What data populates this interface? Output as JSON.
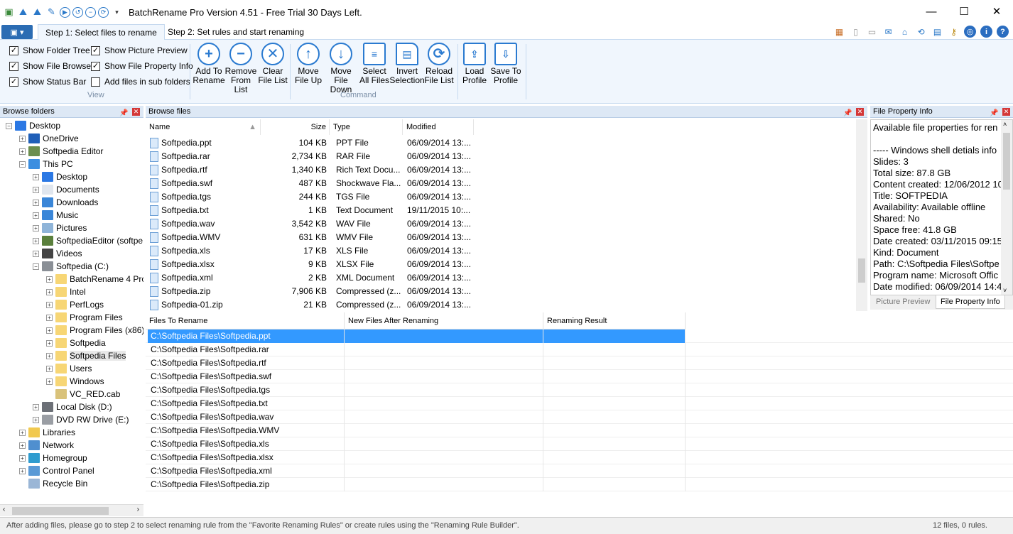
{
  "window": {
    "title": "BatchRename Pro Version 4.51 - Free Trial 30 Days Left.",
    "minimize": "—",
    "maximize": "☐",
    "close": "✕"
  },
  "tabs": [
    {
      "label": "Step 1: Select files to rename",
      "active": true
    },
    {
      "label": "Step 2: Set rules and start renaming",
      "active": false
    }
  ],
  "ribbon": {
    "view_group_label": "View",
    "command_group_label": "Command",
    "checkboxes": [
      {
        "label": "Show Folder Tree",
        "checked": true
      },
      {
        "label": "Show Picture Preview",
        "checked": true
      },
      {
        "label": "Show File Browser",
        "checked": true
      },
      {
        "label": "Show File Property Info",
        "checked": true
      },
      {
        "label": "Show Status Bar",
        "checked": true
      },
      {
        "label": "Add files in sub folders",
        "checked": false
      }
    ],
    "commands": [
      {
        "line1": "Add To",
        "line2": "Rename",
        "icon": "+"
      },
      {
        "line1": "Remove",
        "line2": "From List",
        "icon": "−"
      },
      {
        "line1": "Clear",
        "line2": "File List",
        "icon": "✕"
      },
      {
        "line1": "Move",
        "line2": "File Up",
        "icon": "↑"
      },
      {
        "line1": "Move File",
        "line2": "Down",
        "icon": "↓"
      },
      {
        "line1": "Select",
        "line2": "All Files",
        "icon": "≡"
      },
      {
        "line1": "Invert",
        "line2": "Selection",
        "icon": "▤"
      },
      {
        "line1": "Reload",
        "line2": "File List",
        "icon": "⟳"
      },
      {
        "line1": "Load",
        "line2": "Profile",
        "icon": "⇪"
      },
      {
        "line1": "Save To",
        "line2": "Profile",
        "icon": "⇩"
      }
    ]
  },
  "panels": {
    "browse_folders": "Browse folders",
    "browse_files": "Browse files",
    "file_property_info": "File Property Info"
  },
  "tree": [
    {
      "label": "Desktop",
      "indent": 0,
      "exp": "−",
      "color": "#2b78e4"
    },
    {
      "label": "OneDrive",
      "indent": 1,
      "exp": "+",
      "color": "#1f5fb8"
    },
    {
      "label": "Softpedia Editor",
      "indent": 1,
      "exp": "+",
      "color": "#6b8e4e"
    },
    {
      "label": "This PC",
      "indent": 1,
      "exp": "−",
      "color": "#3b8ee0"
    },
    {
      "label": "Desktop",
      "indent": 2,
      "exp": "+",
      "color": "#2b78e4"
    },
    {
      "label": "Documents",
      "indent": 2,
      "exp": "+",
      "color": "#e0e6ee"
    },
    {
      "label": "Downloads",
      "indent": 2,
      "exp": "+",
      "color": "#3a86d8"
    },
    {
      "label": "Music",
      "indent": 2,
      "exp": "+",
      "color": "#3a86d8"
    },
    {
      "label": "Pictures",
      "indent": 2,
      "exp": "+",
      "color": "#8fb4d8"
    },
    {
      "label": "SoftpediaEditor (softpe",
      "indent": 2,
      "exp": "+",
      "color": "#5a7f3c"
    },
    {
      "label": "Videos",
      "indent": 2,
      "exp": "+",
      "color": "#444444"
    },
    {
      "label": "Softpedia (C:)",
      "indent": 2,
      "exp": "−",
      "color": "#8a8f96"
    },
    {
      "label": "BatchRename 4 Pro",
      "indent": 3,
      "exp": "+",
      "color": "#f7d675"
    },
    {
      "label": "Intel",
      "indent": 3,
      "exp": "+",
      "color": "#f7d675"
    },
    {
      "label": "PerfLogs",
      "indent": 3,
      "exp": "+",
      "color": "#f7d675"
    },
    {
      "label": "Program Files",
      "indent": 3,
      "exp": "+",
      "color": "#f7d675"
    },
    {
      "label": "Program Files (x86)",
      "indent": 3,
      "exp": "+",
      "color": "#f7d675"
    },
    {
      "label": "Softpedia",
      "indent": 3,
      "exp": "+",
      "color": "#f7d675"
    },
    {
      "label": "Softpedia Files",
      "indent": 3,
      "exp": "+",
      "color": "#f7d675",
      "selected": true
    },
    {
      "label": "Users",
      "indent": 3,
      "exp": "+",
      "color": "#f7d675"
    },
    {
      "label": "Windows",
      "indent": 3,
      "exp": "+",
      "color": "#f7d675"
    },
    {
      "label": "VC_RED.cab",
      "indent": 3,
      "exp": "",
      "color": "#d9c27a"
    },
    {
      "label": "Local Disk (D:)",
      "indent": 2,
      "exp": "+",
      "color": "#6c7077"
    },
    {
      "label": "DVD RW Drive (E:)",
      "indent": 2,
      "exp": "+",
      "color": "#9a9ea4"
    },
    {
      "label": "Libraries",
      "indent": 1,
      "exp": "+",
      "color": "#f1c94f"
    },
    {
      "label": "Network",
      "indent": 1,
      "exp": "+",
      "color": "#4f8fcf"
    },
    {
      "label": "Homegroup",
      "indent": 1,
      "exp": "+",
      "color": "#2f9ccf"
    },
    {
      "label": "Control Panel",
      "indent": 1,
      "exp": "+",
      "color": "#5a9ad6"
    },
    {
      "label": "Recycle Bin",
      "indent": 1,
      "exp": "",
      "color": "#9ab6d6"
    }
  ],
  "files_columns": {
    "name": "Name",
    "size": "Size",
    "type": "Type",
    "modified": "Modified"
  },
  "files": [
    {
      "name": "Softpedia.ppt",
      "size": "104 KB",
      "type": "PPT File",
      "modified": "06/09/2014 13:..."
    },
    {
      "name": "Softpedia.rar",
      "size": "2,734 KB",
      "type": "RAR File",
      "modified": "06/09/2014 13:..."
    },
    {
      "name": "Softpedia.rtf",
      "size": "1,340 KB",
      "type": "Rich Text Docu...",
      "modified": "06/09/2014 13:..."
    },
    {
      "name": "Softpedia.swf",
      "size": "487 KB",
      "type": "Shockwave Fla...",
      "modified": "06/09/2014 13:..."
    },
    {
      "name": "Softpedia.tgs",
      "size": "244 KB",
      "type": "TGS File",
      "modified": "06/09/2014 13:..."
    },
    {
      "name": "Softpedia.txt",
      "size": "1 KB",
      "type": "Text Document",
      "modified": "19/11/2015 10:..."
    },
    {
      "name": "Softpedia.wav",
      "size": "3,542 KB",
      "type": "WAV File",
      "modified": "06/09/2014 13:..."
    },
    {
      "name": "Softpedia.WMV",
      "size": "631 KB",
      "type": "WMV File",
      "modified": "06/09/2014 13:..."
    },
    {
      "name": "Softpedia.xls",
      "size": "17 KB",
      "type": "XLS File",
      "modified": "06/09/2014 13:..."
    },
    {
      "name": "Softpedia.xlsx",
      "size": "9 KB",
      "type": "XLSX File",
      "modified": "06/09/2014 13:..."
    },
    {
      "name": "Softpedia.xml",
      "size": "2 KB",
      "type": "XML Document",
      "modified": "06/09/2014 13:..."
    },
    {
      "name": "Softpedia.zip",
      "size": "7,906 KB",
      "type": "Compressed (z...",
      "modified": "06/09/2014 13:..."
    },
    {
      "name": "Softpedia-01.zip",
      "size": "21 KB",
      "type": "Compressed (z...",
      "modified": "06/09/2014 13:..."
    }
  ],
  "rename_columns": {
    "files": "Files To Rename",
    "new": "New Files After Renaming",
    "result": "Renaming Result"
  },
  "rename_rows": [
    "C:\\Softpedia Files\\Softpedia.ppt",
    "C:\\Softpedia Files\\Softpedia.rar",
    "C:\\Softpedia Files\\Softpedia.rtf",
    "C:\\Softpedia Files\\Softpedia.swf",
    "C:\\Softpedia Files\\Softpedia.tgs",
    "C:\\Softpedia Files\\Softpedia.txt",
    "C:\\Softpedia Files\\Softpedia.wav",
    "C:\\Softpedia Files\\Softpedia.WMV",
    "C:\\Softpedia Files\\Softpedia.xls",
    "C:\\Softpedia Files\\Softpedia.xlsx",
    "C:\\Softpedia Files\\Softpedia.xml",
    "C:\\Softpedia Files\\Softpedia.zip"
  ],
  "properties": [
    "Available file properties for ren",
    "",
    "----- Windows shell detials info",
    "Slides: 3",
    "Total size: 87.8 GB",
    "Content created: 12/06/2012 10",
    "Title: SOFTPEDIA",
    "Availability: Available offline",
    "Shared: No",
    "Space free: 41.8 GB",
    "Date created: 03/11/2015 09:15",
    "Kind: Document",
    "Path: C:\\Softpedia Files\\Softpe",
    "Program name: Microsoft Offic",
    "Date modified: 06/09/2014 14:4"
  ],
  "property_tabs": {
    "preview": "Picture Preview",
    "info": "File Property Info"
  },
  "status": {
    "message": "After adding files, please go to step 2 to select renaming rule from the \"Favorite Renaming Rules\" or create rules using the \"Renaming Rule Builder\".",
    "count": "12 files, 0 rules."
  }
}
